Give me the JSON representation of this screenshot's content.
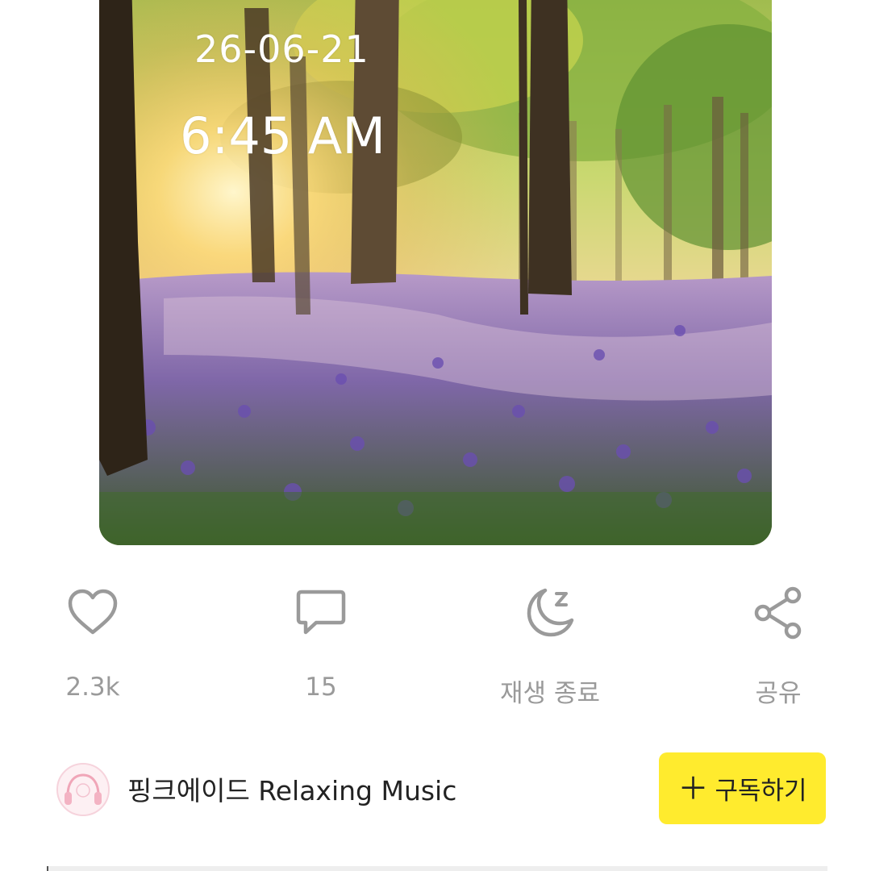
{
  "artwork": {
    "date_overlay": "26-06-21",
    "time_overlay": "6:45 AM"
  },
  "actions": {
    "like": {
      "label": "2.3k",
      "icon": "heart-icon"
    },
    "comment": {
      "label": "15",
      "icon": "chat-bubble-icon"
    },
    "sleep_timer": {
      "label": "재생 종료",
      "icon": "moon-sleep-icon"
    },
    "share": {
      "label": "공유",
      "icon": "share-icon"
    }
  },
  "channel": {
    "name": "핑크에이드 Relaxing Music",
    "avatar_icon": "pink-headphones-logo",
    "subscribe_label": "구독하기",
    "subscribe_icon": "plus-icon",
    "accent_color": "#ffeb2e"
  },
  "colors": {
    "icon_gray": "#9a9a9a",
    "text_dark": "#222222"
  }
}
